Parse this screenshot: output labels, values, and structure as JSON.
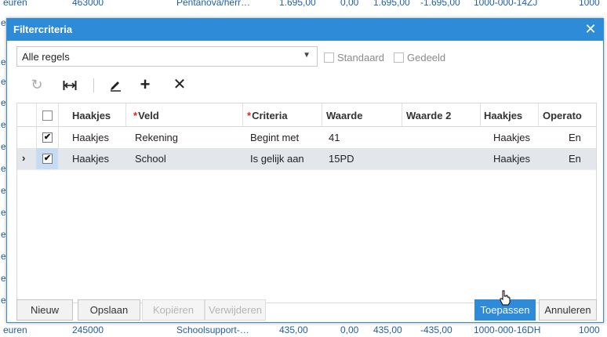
{
  "background": {
    "top_row": [
      "euren",
      "463000",
      "Pentanova/herr…",
      "1.695,00",
      "0,00",
      "1.695,00",
      "-1.695,00",
      "1000-000-14ZJ",
      "1000"
    ],
    "bottom_row": [
      "euren",
      "245000",
      "Schoolsupport-…",
      "435,00",
      "0,00",
      "435,00",
      "-435,00",
      "1000-000-16DH",
      "1000"
    ],
    "left_letters": [
      "e",
      "e",
      "e",
      "e",
      "e",
      "e",
      "e",
      "e",
      "e",
      "e",
      "e",
      "e",
      "e"
    ]
  },
  "dialog": {
    "title": "Filtercriteria",
    "select_value": "Alle regels",
    "standaard_label": "Standaard",
    "gedeeld_label": "Gedeeld"
  },
  "toolbar": {
    "icons": [
      "refresh-icon",
      "fit-width-icon",
      "edit-icon",
      "add-icon",
      "delete-icon"
    ]
  },
  "grid": {
    "columns": [
      "Haakjes",
      "Veld",
      "Criteria",
      "Waarde",
      "Waarde 2",
      "Haakjes",
      "Operato"
    ],
    "required_marker": "*",
    "rows": [
      {
        "checked": "✔",
        "haakjes1": "Haakjes",
        "veld": "Rekening",
        "criteria": "Begint met",
        "waarde": "41",
        "waarde2": "",
        "haakjes2": "Haakjes",
        "operator": "En"
      },
      {
        "checked": "✔",
        "haakjes1": "Haakjes",
        "veld": "School",
        "criteria": "Is gelijk aan",
        "waarde": "15PD",
        "waarde2": "",
        "haakjes2": "Haakjes",
        "operator": "En"
      }
    ]
  },
  "footer": {
    "nieuw": "Nieuw",
    "opslaan": "Opslaan",
    "kopieren": "Kopiëren",
    "verwijderen": "Verwijderen",
    "toepassen": "Toepassen",
    "annuleren": "Annuleren"
  },
  "colors": {
    "accent": "#2e8bd8",
    "required": "#d9261c",
    "selected_row": "#e3e6eb"
  }
}
